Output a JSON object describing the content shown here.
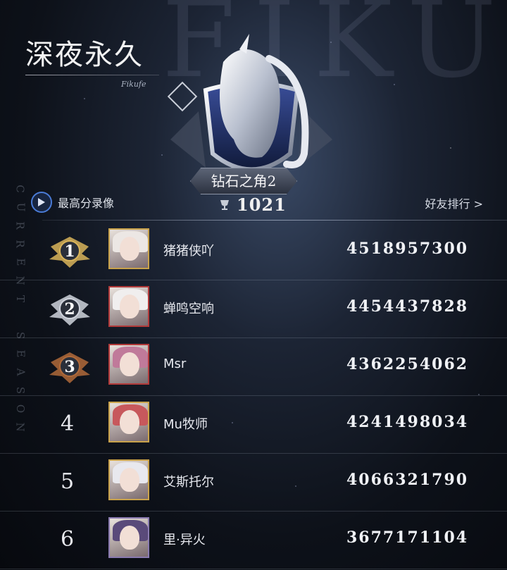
{
  "header": {
    "title": "深夜永久",
    "subtitle": "Fikufe",
    "watermark": "FIKU",
    "season_vertical": "CURRENT SEASON"
  },
  "rank": {
    "tier": "钻石之角2",
    "score": "1021",
    "emblem_icon": "winged-unicorn-shield-icon"
  },
  "actions": {
    "replay_label": "最高分录像",
    "friends_label": "好友排行 >"
  },
  "leaderboard": [
    {
      "rank": "1",
      "name": "猪猪侠吖",
      "score": "4518957300",
      "medal": "gold",
      "frame": "#c9a24a",
      "hair": "#ece7e4"
    },
    {
      "rank": "2",
      "name": "蝉鸣空响",
      "score": "4454437828",
      "medal": "silver",
      "frame": "#b23a3a",
      "hair": "#f0eeee"
    },
    {
      "rank": "3",
      "name": "Msr",
      "score": "4362254062",
      "medal": "bronze",
      "frame": "#b23a3a",
      "hair": "#c07a9a"
    },
    {
      "rank": "4",
      "name": "Mu牧师",
      "score": "4241498034",
      "medal": "none",
      "frame": "#c9a24a",
      "hair": "#c7585c"
    },
    {
      "rank": "5",
      "name": "艾斯托尔",
      "score": "4066321790",
      "medal": "none",
      "frame": "#c9a24a",
      "hair": "#e8e8ee"
    },
    {
      "rank": "6",
      "name": "里·异火",
      "score": "3677171104",
      "medal": "none",
      "frame": "#8a7ab0",
      "hair": "#5a4a7a"
    }
  ],
  "colors": {
    "gold": "#d9b45a",
    "silver": "#cfd3dc",
    "bronze": "#b06a3a"
  }
}
